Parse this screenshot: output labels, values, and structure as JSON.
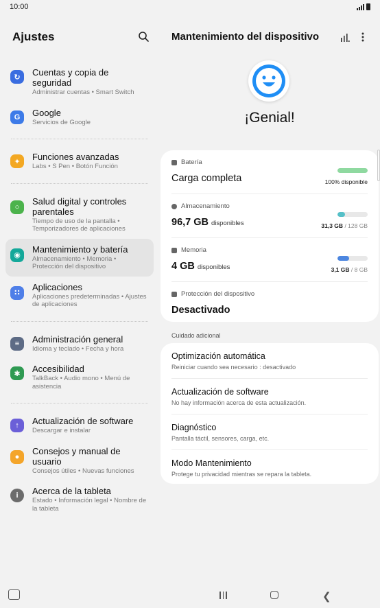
{
  "status": {
    "time": "10:00"
  },
  "left": {
    "title": "Ajustes",
    "items": [
      {
        "title": "Cuentas y copia de seguridad",
        "sub": "Administrar cuentas  •  Smart Switch",
        "color": "#3a6de0",
        "icon": "sync-icon"
      },
      {
        "title": "Google",
        "sub": "Servicios de Google",
        "color": "#3d7be8",
        "icon": "google-icon"
      },
      {
        "title": "Funciones avanzadas",
        "sub": "Labs  •  S Pen  •  Botón Función",
        "color": "#f3a823",
        "icon": "gear-star-icon"
      },
      {
        "title": "Salud digital y controles parentales",
        "sub": "Tiempo de uso de la pantalla  •  Temporizadores de aplicaciones",
        "color": "#4cb34c",
        "icon": "wellbeing-icon"
      },
      {
        "title": "Mantenimiento y batería",
        "sub": "Almacenamiento  •  Memoria  •  Protección del dispositivo",
        "color": "#14a89a",
        "icon": "device-care-icon"
      },
      {
        "title": "Aplicaciones",
        "sub": "Aplicaciones predeterminadas  •  Ajustes de aplicaciones",
        "color": "#4f7fe8",
        "icon": "apps-grid-icon"
      },
      {
        "title": "Administración general",
        "sub": "Idioma y teclado  •  Fecha y hora",
        "color": "#5d6b85",
        "icon": "sliders-icon"
      },
      {
        "title": "Accesibilidad",
        "sub": "TalkBack  •  Audio mono  •  Menú de asistencia",
        "color": "#2f9a52",
        "icon": "accessibility-icon"
      },
      {
        "title": "Actualización de software",
        "sub": "Descargar e instalar",
        "color": "#6b5fd8",
        "icon": "software-update-icon"
      },
      {
        "title": "Consejos y manual de usuario",
        "sub": "Consejos útiles  •  Nuevas funciones",
        "color": "#f4a52a",
        "icon": "lightbulb-icon"
      },
      {
        "title": "Acerca de la tableta",
        "sub": "Estado  •  Información legal  •  Nombre de la tableta",
        "color": "#6c6c6c",
        "icon": "info-icon"
      }
    ]
  },
  "right": {
    "title": "Mantenimiento del dispositivo",
    "status": "¡Genial!",
    "battery": {
      "label": "Batería",
      "value": "Carga completa",
      "right": "100% disponible",
      "level": 1.0,
      "color": "#8fd9a0"
    },
    "storage": {
      "label": "Almacenamiento",
      "value": "96,7 GB",
      "unit": "disponibles",
      "used": "31,3 GB",
      "total": "/ 128 GB",
      "level": 0.245,
      "color": "#56c0c8"
    },
    "memory": {
      "label": "Memoria",
      "value": "4 GB",
      "unit": "disponibles",
      "used": "3,1 GB",
      "total": "/ 8 GB",
      "level": 0.39,
      "color": "#4c86e0"
    },
    "protection": {
      "label": "Protección del dispositivo",
      "value": "Desactivado"
    },
    "section_label": "Cuidado adicional",
    "options": [
      {
        "title": "Optimización automática",
        "sub": "Reiniciar cuando sea necesario : desactivado"
      },
      {
        "title": "Actualización de software",
        "sub": "No hay información acerca de esta actualización."
      },
      {
        "title": "Diagnóstico",
        "sub": "Pantalla táctil, sensores, carga, etc."
      },
      {
        "title": "Modo Mantenimiento",
        "sub": "Protege tu privacidad mientras se repara la tableta."
      }
    ]
  }
}
